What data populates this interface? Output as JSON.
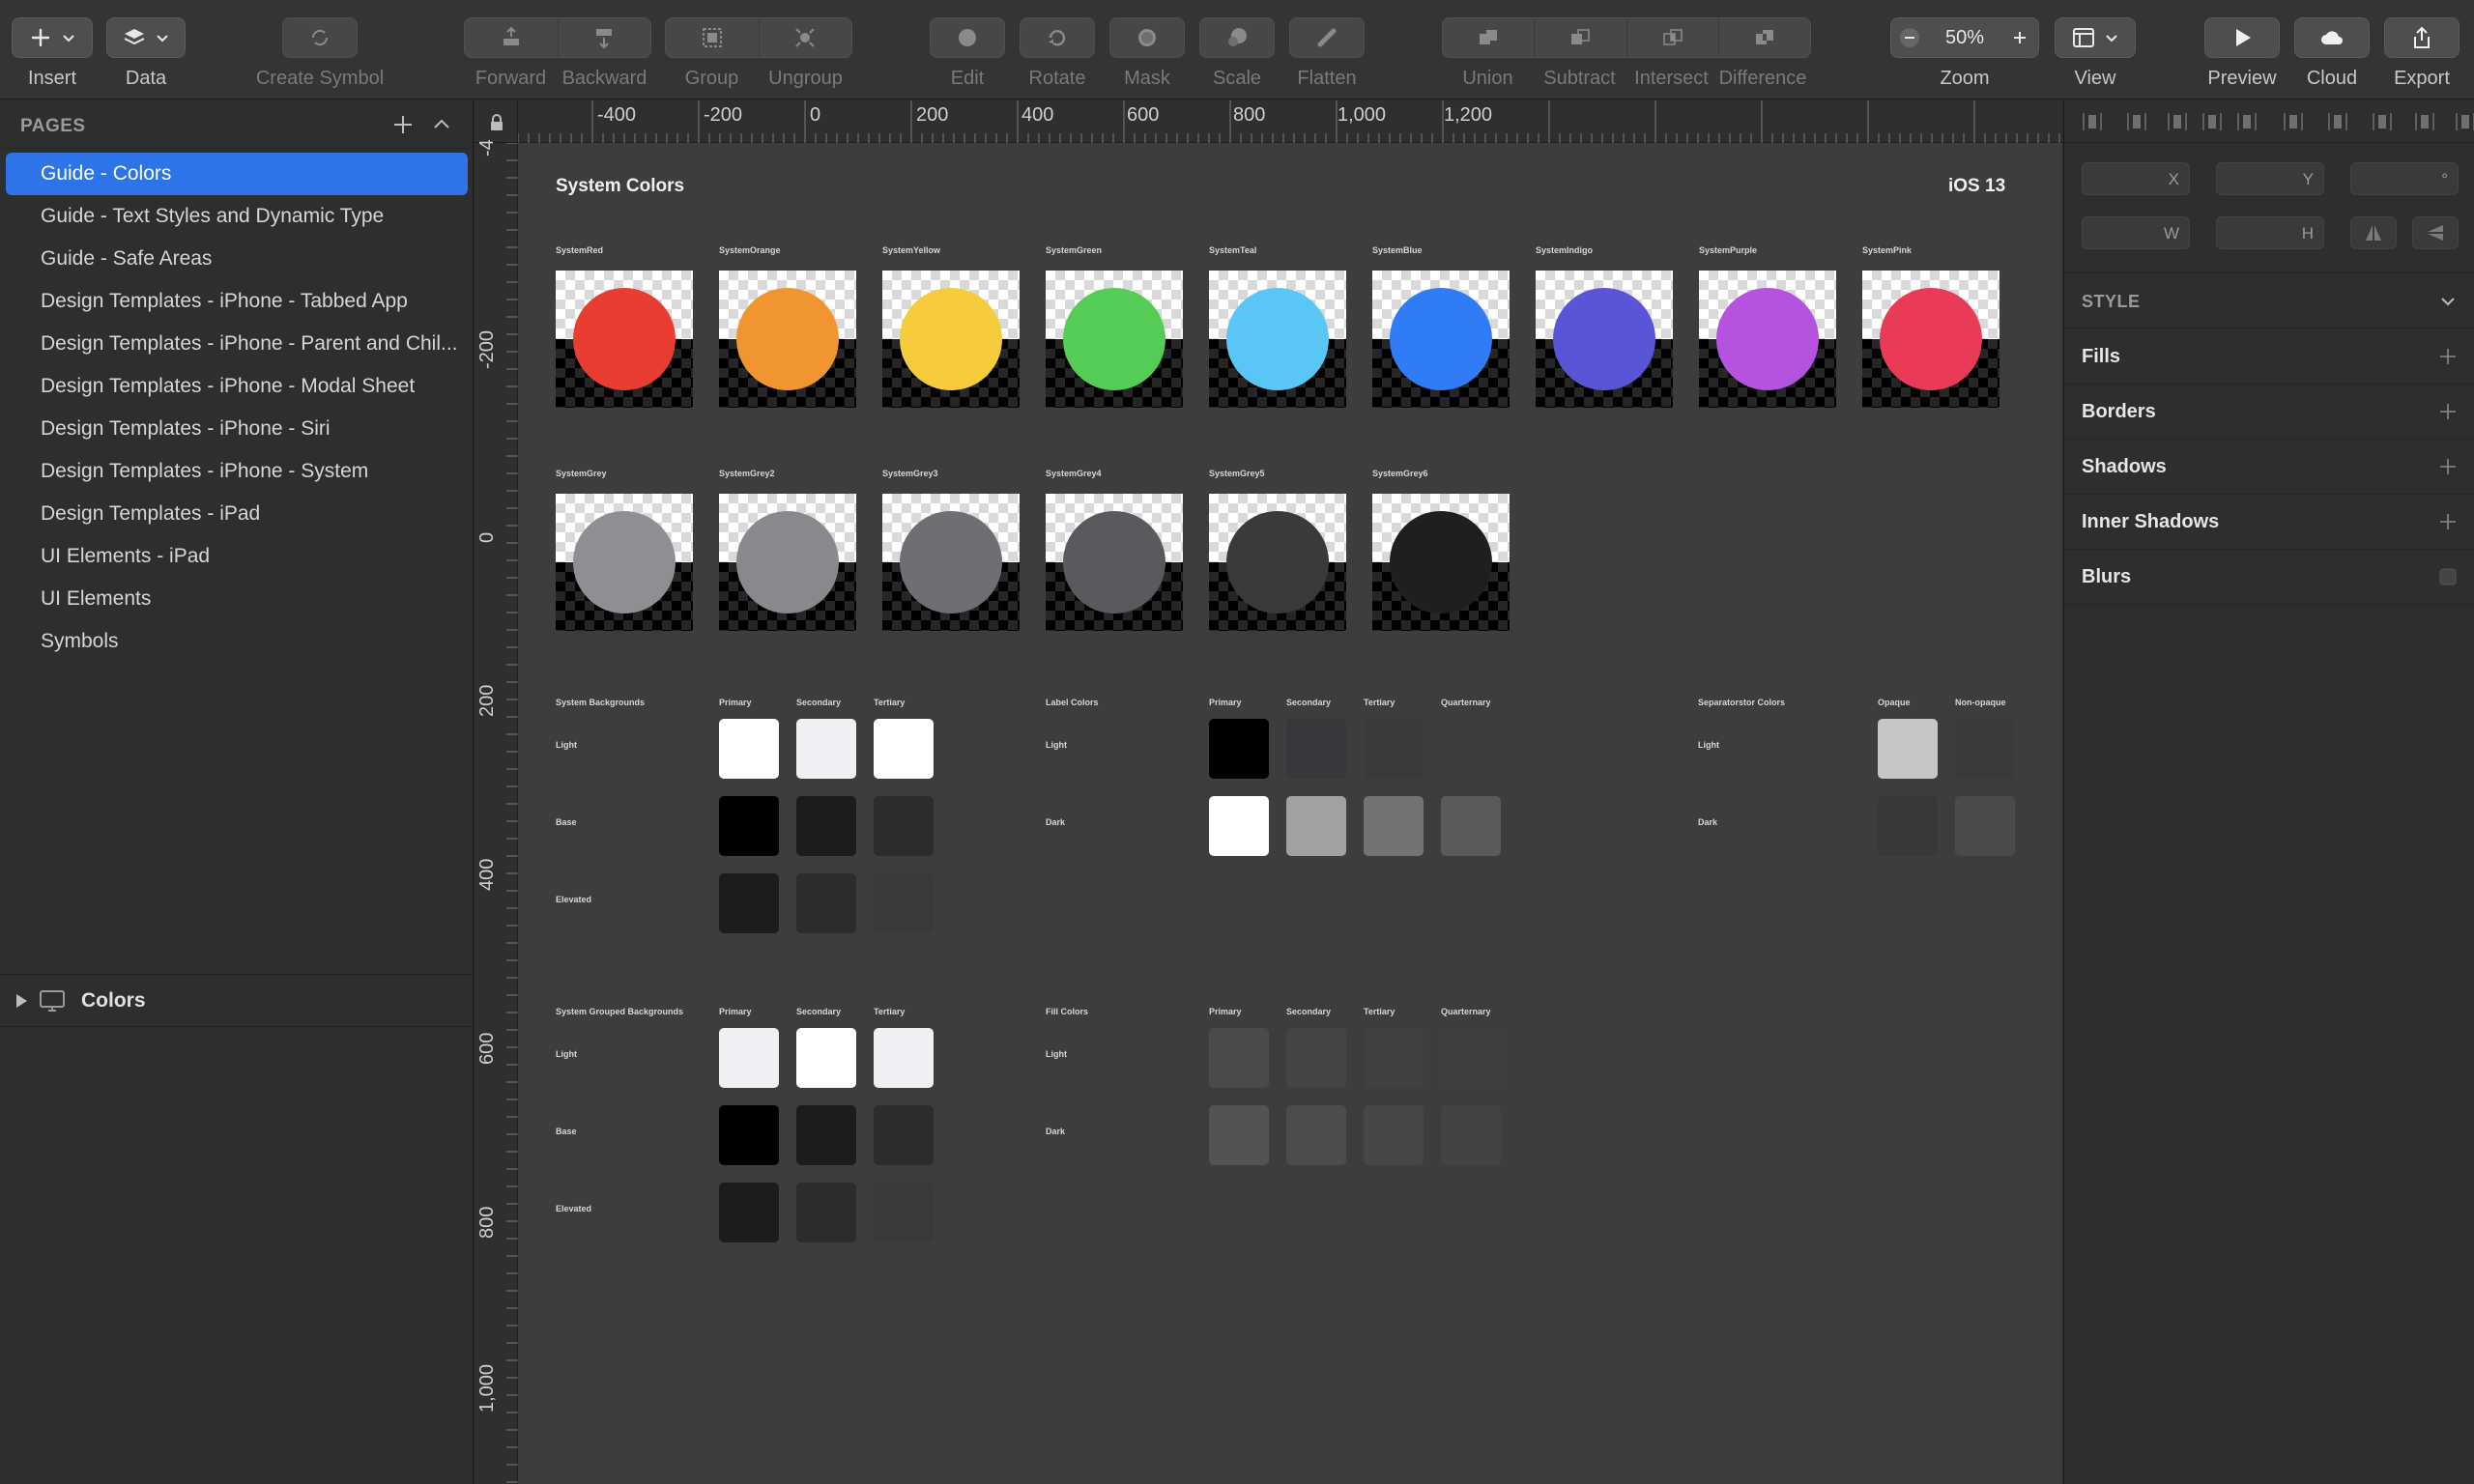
{
  "toolbar": {
    "insert_label": "Insert",
    "data_label": "Data",
    "create_symbol_label": "Create Symbol",
    "forward_label": "Forward",
    "backward_label": "Backward",
    "group_label": "Group",
    "ungroup_label": "Ungroup",
    "edit_label": "Edit",
    "rotate_label": "Rotate",
    "mask_label": "Mask",
    "scale_label": "Scale",
    "flatten_label": "Flatten",
    "union_label": "Union",
    "subtract_label": "Subtract",
    "intersect_label": "Intersect",
    "difference_label": "Difference",
    "zoom_value": "50%",
    "zoom_label": "Zoom",
    "view_label": "View",
    "preview_label": "Preview",
    "cloud_label": "Cloud",
    "export_label": "Export"
  },
  "sidebar": {
    "pages_title": "PAGES",
    "pages": [
      {
        "label": "Guide - Colors",
        "active": true
      },
      {
        "label": "Guide - Text Styles and Dynamic Type"
      },
      {
        "label": "Guide - Safe Areas"
      },
      {
        "label": "Design Templates - iPhone - Tabbed App"
      },
      {
        "label": "Design Templates - iPhone - Parent and Chil..."
      },
      {
        "label": "Design Templates - iPhone - Modal Sheet"
      },
      {
        "label": "Design Templates - iPhone - Siri"
      },
      {
        "label": "Design Templates - iPhone - System"
      },
      {
        "label": "Design Templates - iPad"
      },
      {
        "label": "UI Elements - iPad"
      },
      {
        "label": "UI Elements"
      },
      {
        "label": "Symbols"
      }
    ],
    "layer_name": "Colors"
  },
  "rulers": {
    "horizontal": [
      "-400",
      "-200",
      "0",
      "200",
      "400",
      "600",
      "800",
      "1,000",
      "1,200"
    ],
    "vertical": [
      "-4",
      "-200",
      "0",
      "200",
      "400",
      "600",
      "800",
      "1,000"
    ]
  },
  "artboard": {
    "title": "System Colors",
    "platform": "iOS 13",
    "system_colors": [
      {
        "name": "SystemRed",
        "color": "#ea3d32"
      },
      {
        "name": "SystemOrange",
        "color": "#f0952f"
      },
      {
        "name": "SystemYellow",
        "color": "#f6cc3d"
      },
      {
        "name": "SystemGreen",
        "color": "#54cc55"
      },
      {
        "name": "SystemTeal",
        "color": "#5ac6f6"
      },
      {
        "name": "SystemBlue",
        "color": "#2f7cf6"
      },
      {
        "name": "SystemIndigo",
        "color": "#5a55d6"
      },
      {
        "name": "SystemPurple",
        "color": "#b552e0"
      },
      {
        "name": "SystemPink",
        "color": "#e93a57"
      }
    ],
    "system_greys": [
      {
        "name": "SystemGrey",
        "color": "#8e8e93"
      },
      {
        "name": "SystemGrey2",
        "color": "#88888d"
      },
      {
        "name": "SystemGrey3",
        "color": "#6e6e73"
      },
      {
        "name": "SystemGrey4",
        "color": "#595a5e"
      },
      {
        "name": "SystemGrey5",
        "color": "#3a3a3c"
      },
      {
        "name": "SystemGrey6",
        "color": "#1f1f21"
      }
    ],
    "system_backgrounds": {
      "title": "System Backgrounds",
      "columns": [
        "Primary",
        "Secondary",
        "Tertiary"
      ],
      "rows": [
        {
          "label": "Light",
          "colors": [
            "#ffffff",
            "#efeff4",
            "#ffffff"
          ]
        },
        {
          "label": "Base",
          "colors": [
            "#000000",
            "#1c1c1e",
            "#2c2c2e"
          ]
        },
        {
          "label": "Elevated",
          "colors": [
            "#1c1c1e",
            "#2c2c2e",
            "#3a3a3c"
          ]
        }
      ]
    },
    "label_colors": {
      "title": "Label Colors",
      "columns": [
        "Primary",
        "Secondary",
        "Tertiary",
        "Quarternary"
      ],
      "rows": [
        {
          "label": "Light",
          "colors": [
            "#000000",
            "#38383c",
            "#3a3a3d",
            "#3c3c3e"
          ]
        },
        {
          "label": "Dark",
          "colors": [
            "#ffffff",
            "#a1a1a3",
            "#737375",
            "#5a5a5d"
          ]
        }
      ]
    },
    "separator_colors": {
      "title": "Separatorstor Colors",
      "columns": [
        "Opaque",
        "Non-opaque"
      ],
      "rows": [
        {
          "label": "Light",
          "colors": [
            "#c6c6c8",
            "#3a3a3c"
          ]
        },
        {
          "label": "Dark",
          "colors": [
            "#38383a",
            "#4a4a4d"
          ]
        }
      ]
    },
    "grouped_backgrounds": {
      "title": "System Grouped Backgrounds",
      "columns": [
        "Primary",
        "Secondary",
        "Tertiary"
      ],
      "rows": [
        {
          "label": "Light",
          "colors": [
            "#efeff4",
            "#ffffff",
            "#efeff4"
          ]
        },
        {
          "label": "Base",
          "colors": [
            "#000000",
            "#1c1c1e",
            "#2c2c2e"
          ]
        },
        {
          "label": "Elevated",
          "colors": [
            "#1c1c1e",
            "#2c2c2e",
            "#3a3a3c"
          ]
        }
      ]
    },
    "fill_colors": {
      "title": "Fill Colors",
      "columns": [
        "Primary",
        "Secondary",
        "Tertiary",
        "Quarternary"
      ],
      "rows": [
        {
          "label": "Light",
          "colors": [
            "#4a4a4d",
            "#444446",
            "#404042",
            "#3e3e40"
          ]
        },
        {
          "label": "Dark",
          "colors": [
            "#535356",
            "#4c4c4f",
            "#474749",
            "#434345"
          ]
        }
      ]
    }
  },
  "inspector": {
    "x_suffix": "X",
    "y_suffix": "Y",
    "rotation_suffix": "°",
    "w_suffix": "W",
    "h_suffix": "H",
    "style_title": "STYLE",
    "rows": [
      "Fills",
      "Borders",
      "Shadows",
      "Inner Shadows",
      "Blurs"
    ]
  },
  "colors": {
    "accent": "#2d74e8",
    "canvas": "#3d3d3d",
    "toolbar": "#343434",
    "panel": "#2e2e2e"
  }
}
